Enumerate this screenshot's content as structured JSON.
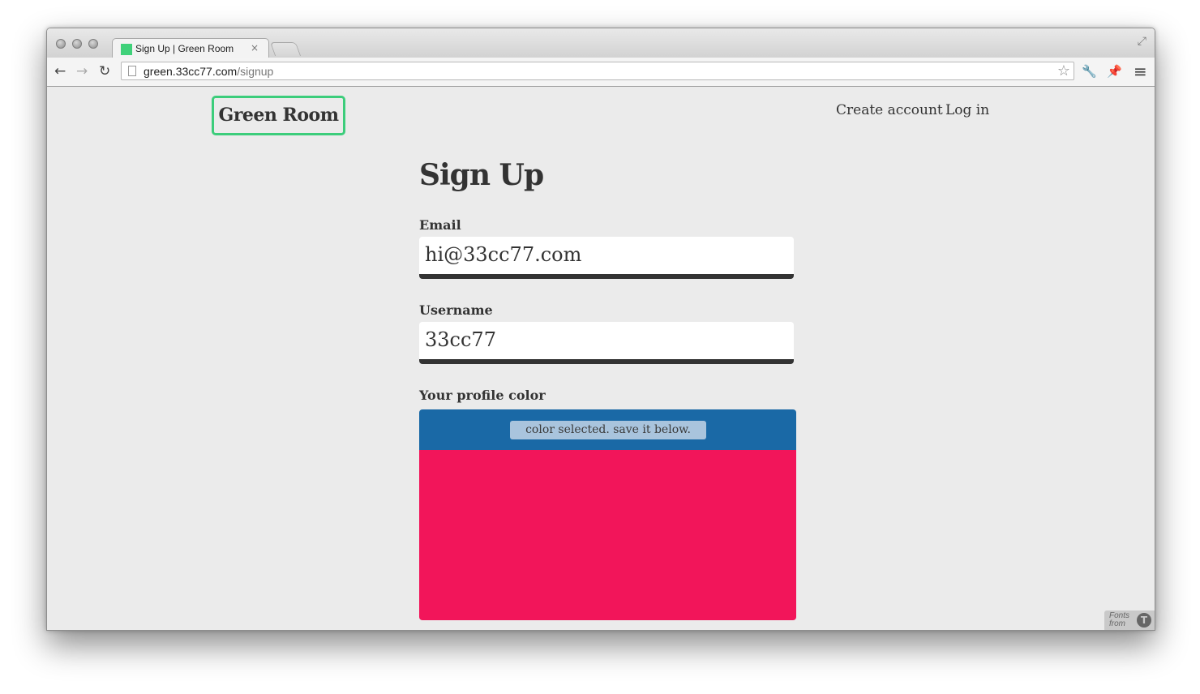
{
  "browser": {
    "tab_title": "Sign Up | Green Room",
    "tab_close": "×",
    "url_host": "green.33cc77.com",
    "url_path": "/signup",
    "icons": {
      "back": "←",
      "forward": "→",
      "reload": "↻",
      "star": "☆",
      "wrench": "🔧",
      "pin": "📌",
      "menu": "≡",
      "fullscreen": "⤢"
    }
  },
  "header": {
    "logo": "Green Room",
    "nav": {
      "create_account": "Create account",
      "log_in": "Log in"
    }
  },
  "main": {
    "title": "Sign Up",
    "email": {
      "label": "Email",
      "value": "hi@33cc77.com"
    },
    "username": {
      "label": "Username",
      "value": "33cc77"
    },
    "profile_color": {
      "label": "Your profile color",
      "status": "color selected. save it below.",
      "header_color": "#1a69a6",
      "selected_color": "#f2155a"
    }
  },
  "footer_badge": {
    "text": "Fonts from",
    "icon": "T"
  },
  "colors": {
    "accent": "#3ccd7b",
    "text": "#333333",
    "page_bg": "#ebebeb"
  }
}
